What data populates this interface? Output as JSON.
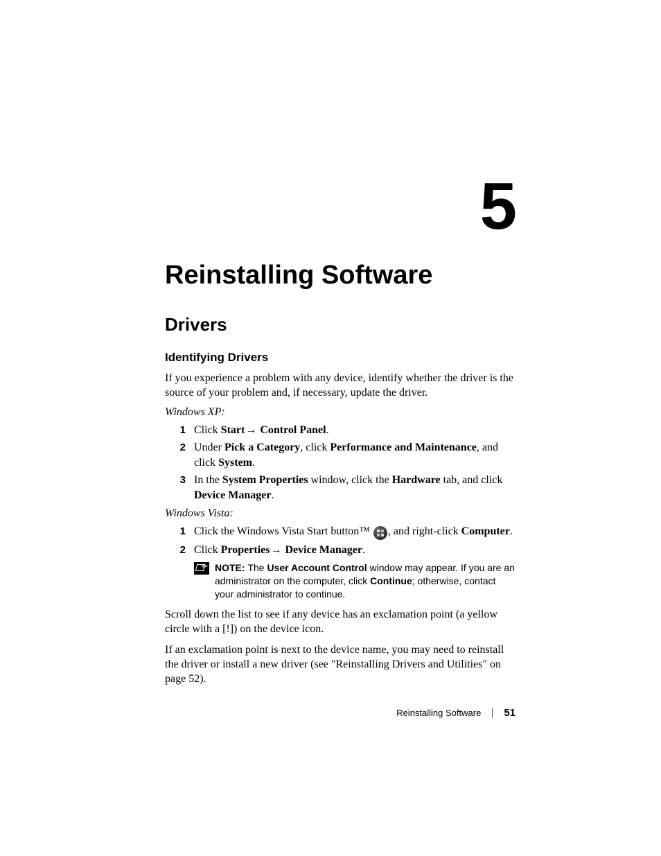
{
  "chapter": {
    "number": "5",
    "title": "Reinstalling Software"
  },
  "h1": "Drivers",
  "h2": "Identifying Drivers",
  "intro": "If you experience a problem with any device, identify whether the driver is the source of your problem and, if necessary, update the driver.",
  "xp": {
    "label": "Windows XP:",
    "steps": {
      "s1": {
        "a": "Click ",
        "b1": "Start",
        "arrow": "→ ",
        "b2": "Control Panel",
        "c": "."
      },
      "s2": {
        "a": "Under ",
        "b1": "Pick a Category",
        "mid": ", click ",
        "b2": "Performance and Maintenance",
        "mid2": ", and click ",
        "b3": "System",
        "c": "."
      },
      "s3": {
        "a": "In the ",
        "b1": "System Properties",
        "mid": " window, click the ",
        "b2": "Hardware",
        "mid2": " tab, and click ",
        "b3": "Device Manager",
        "c": "."
      }
    }
  },
  "vista": {
    "label": "Windows Vista:",
    "steps": {
      "s1": {
        "a": "Click the Windows Vista Start button™ ",
        "mid": ", and right-click ",
        "b1": "Computer",
        "c": "."
      },
      "s2": {
        "a": "Click ",
        "b1": "Properties",
        "arrow": "→ ",
        "b2": "Device Manager",
        "c": "."
      }
    }
  },
  "note": {
    "label": "NOTE: ",
    "t1": "The ",
    "b1": "User Account Control",
    "t2": " window may appear. If you are an administrator on the computer, click ",
    "b2": "Continue",
    "t3": "; otherwise, contact your administrator to continue."
  },
  "after1": "Scroll down the list to see if any device has an exclamation point (a yellow circle with a [!]) on the device icon.",
  "after2": "If an exclamation point is next to the device name, you may need to reinstall the driver or install a new driver (see \"Reinstalling Drivers and Utilities\" on page 52).",
  "footer": {
    "section": "Reinstalling Software",
    "page": "51"
  }
}
